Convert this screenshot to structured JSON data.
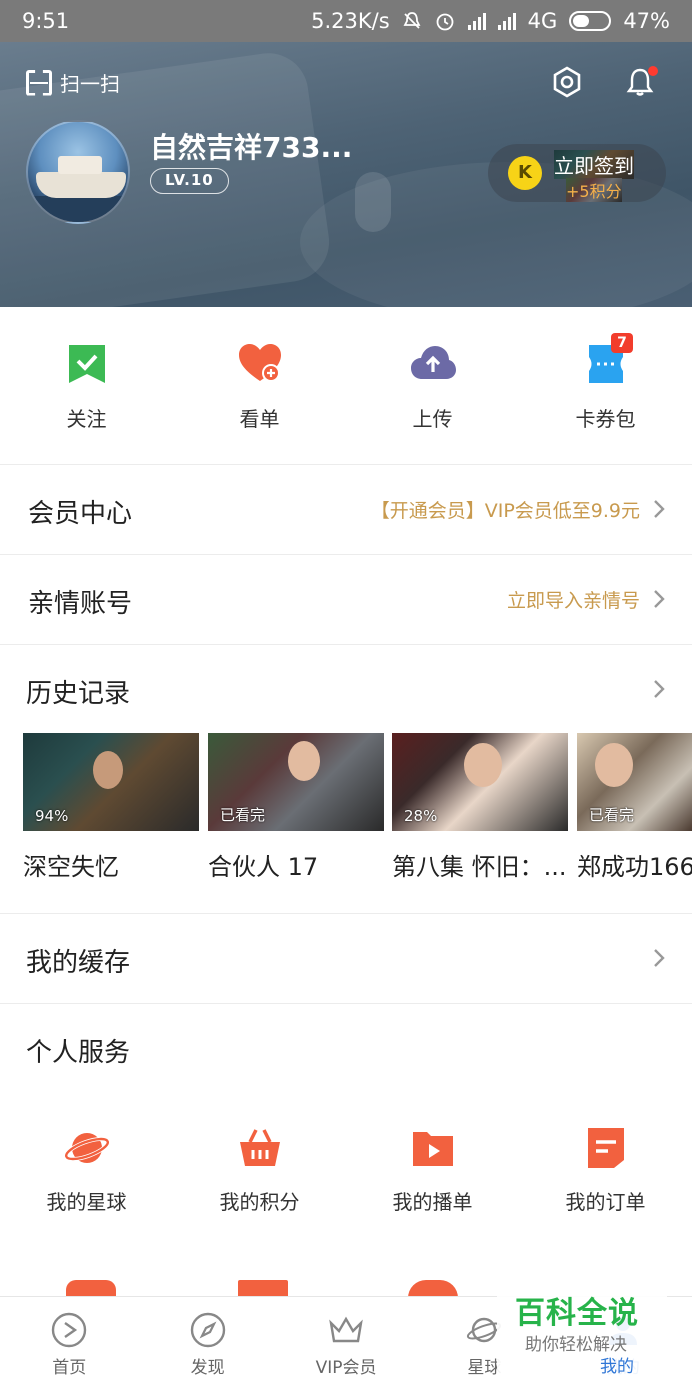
{
  "status_bar": {
    "time": "9:51",
    "speed": "5.23K/s",
    "network": "4G",
    "battery": "47%"
  },
  "header": {
    "scan_label": "扫一扫",
    "username": "自然吉祥733...",
    "level": "LV.10",
    "signin_title": "立即签到",
    "signin_reward": "+5积分",
    "signin_icon_letter": "K"
  },
  "quick_actions": [
    {
      "label": "关注",
      "icon": "bookmark-check-icon",
      "color": "#3cba54"
    },
    {
      "label": "看单",
      "icon": "heart-plus-icon",
      "color": "#f2613f"
    },
    {
      "label": "上传",
      "icon": "cloud-upload-icon",
      "color": "#6c6aa6"
    },
    {
      "label": "卡券包",
      "icon": "ticket-icon",
      "color": "#2aa3f0",
      "badge": "7"
    }
  ],
  "rows": {
    "vip": {
      "title": "会员中心",
      "sub": "【开通会员】VIP会员低至9.9元"
    },
    "family": {
      "title": "亲情账号",
      "sub": "立即导入亲情号"
    },
    "history": {
      "title": "历史记录"
    },
    "cache": {
      "title": "我的缓存"
    },
    "services": {
      "title": "个人服务"
    }
  },
  "history": [
    {
      "title": "深空失忆",
      "progress": "94%"
    },
    {
      "title": "合伙人 17",
      "progress": "已看完"
    },
    {
      "title": "第八集 怀旧：...",
      "progress": "28%"
    },
    {
      "title": "郑成功166",
      "progress": "已看完"
    }
  ],
  "services": [
    {
      "label": "我的星球",
      "icon": "planet-icon"
    },
    {
      "label": "我的积分",
      "icon": "basket-icon"
    },
    {
      "label": "我的播单",
      "icon": "playlist-icon"
    },
    {
      "label": "我的订单",
      "icon": "order-icon"
    }
  ],
  "bottom_nav": [
    {
      "label": "首页",
      "icon": "play-circle-icon"
    },
    {
      "label": "发现",
      "icon": "compass-icon"
    },
    {
      "label": "VIP会员",
      "icon": "crown-icon"
    },
    {
      "label": "星球",
      "icon": "planet-icon"
    },
    {
      "label": "我的",
      "icon": "user-icon",
      "active": true
    }
  ],
  "watermark": {
    "title": "百科全说",
    "subtitle": "助你轻松解决"
  },
  "colors": {
    "accent": "#f2613f",
    "gold": "#c89a4e",
    "active_tab": "#2f76d6",
    "header_bg": "#4e6375"
  }
}
